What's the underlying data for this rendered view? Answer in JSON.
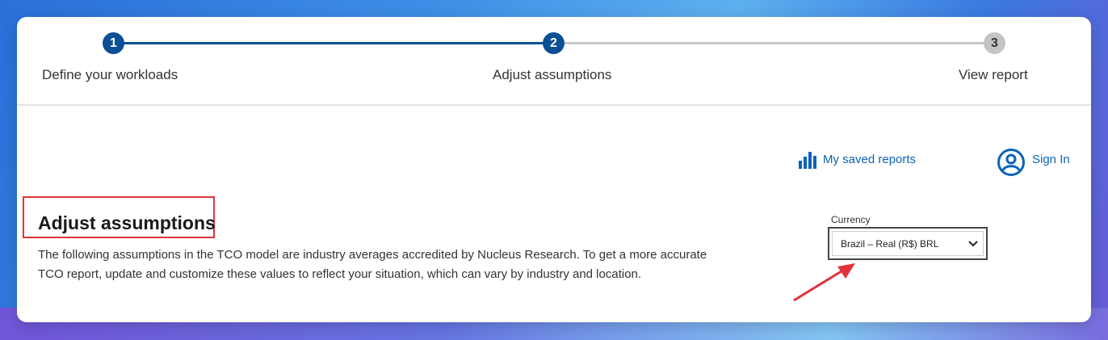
{
  "stepper": {
    "steps": [
      {
        "number": "1",
        "label": "Define your workloads"
      },
      {
        "number": "2",
        "label": "Adjust assumptions"
      },
      {
        "number": "3",
        "label": "View report"
      }
    ],
    "current_step": 2
  },
  "header_links": {
    "saved_reports": "My saved reports",
    "sign_in": "Sign In"
  },
  "main": {
    "title": "Adjust assumptions",
    "description": "The following assumptions in the TCO model are industry averages accredited by Nucleus Research. To get a more accurate TCO report, update and customize these values to reflect your situation, which can vary by industry and location."
  },
  "currency": {
    "label": "Currency",
    "selected": "Brazil – Real (R$) BRL"
  },
  "colors": {
    "accent": "#0b4f95",
    "link": "#0c63b8",
    "annotation": "#e0333a"
  }
}
